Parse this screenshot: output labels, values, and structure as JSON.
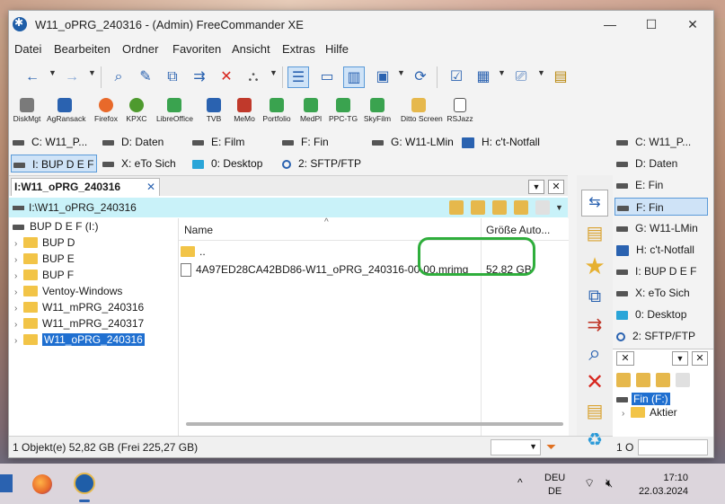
{
  "window": {
    "title": "W11_oPRG_240316 - (Admin) FreeCommander XE",
    "controls": {
      "minimize": "—",
      "maximize": "☐",
      "close": "✕"
    }
  },
  "menu": [
    "Datei",
    "Bearbeiten",
    "Ordner",
    "Favoriten",
    "Ansicht",
    "Extras",
    "Hilfe"
  ],
  "quicklaunch": [
    {
      "label": "DiskMgt",
      "color": "#7a7a7a"
    },
    {
      "label": "AgRansack",
      "color": "#2a62b0"
    },
    {
      "label": "Firefox",
      "color": "#e8692a"
    },
    {
      "label": "KPXC",
      "color": "#4e9a2e"
    },
    {
      "label": "LibreOffice",
      "color": "#3aa34f"
    },
    {
      "label": "TVB",
      "color": "#2a62b0"
    },
    {
      "label": "MeMo",
      "color": "#c0392b"
    },
    {
      "label": "Portfolio",
      "color": "#3aa34f"
    },
    {
      "label": "MedPl",
      "color": "#3aa34f"
    },
    {
      "label": "PPC-TG",
      "color": "#3aa34f"
    },
    {
      "label": "SkyFilm",
      "color": "#3aa34f"
    },
    {
      "label": "Ditto Screen",
      "color": "#e6b84c"
    },
    {
      "label": "RSJazz",
      "color": "#555555"
    }
  ],
  "drives_left": [
    "C: W11_P...",
    "D: Daten",
    "E: Film",
    "F: Fin",
    "G: W11-LMin",
    "H: c't-Notfall",
    "I: BUP D E F",
    "X: eTo Sich",
    "0: Desktop",
    "2: SFTP/FTP"
  ],
  "left_panel": {
    "tab": "I:W11_oPRG_240316",
    "tab_close": "✕",
    "path": "I:\\W11_oPRG_240316",
    "tree_root": "BUP D E F (I:)",
    "tree": [
      "BUP D",
      "BUP E",
      "BUP F",
      "Ventoy-Windows",
      "W11_mPRG_240316",
      "W11_mPRG_240317",
      "W11_oPRG_240316"
    ],
    "columns": {
      "name": "Name",
      "size": "Größe Auto..."
    },
    "files": [
      {
        "name": "..",
        "size": ""
      },
      {
        "name": "4A97ED28CA42BD86-W11_oPRG_240316-00-00.mrimg",
        "size": "52,82 GB"
      }
    ]
  },
  "status": {
    "left": "1 Objekt(e)    52,82 GB    (Frei 225,27 GB)",
    "right": "1 O"
  },
  "drives_right": [
    "C: W11_P...",
    "D: Daten",
    "E: Fin",
    "F: Fin",
    "G: W11-LMin",
    "H: c't-Notfall",
    "I: BUP D E F",
    "X: eTo Sich",
    "0: Desktop",
    "2: SFTP/FTP"
  ],
  "right_panel": {
    "close": "✕",
    "tree_root": "Fin (F:)",
    "tree_child": "Aktier"
  },
  "taskbar": {
    "lang_top": "DEU",
    "lang_bottom": "DE",
    "time": "17:10",
    "date": "22.03.2024"
  }
}
